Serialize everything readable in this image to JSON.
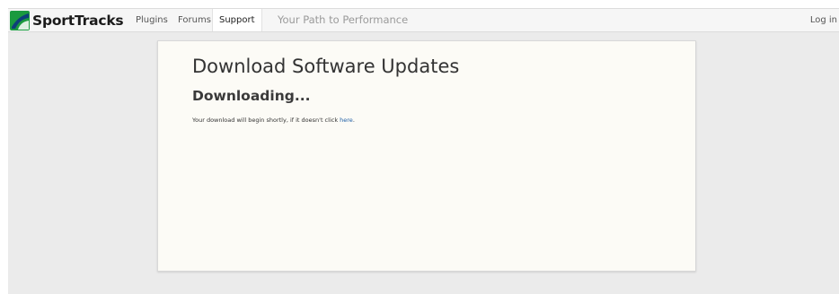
{
  "brand": {
    "name": "SportTracks",
    "logo_icon": "sporttracks-logo-icon",
    "logo_colors": {
      "background": "#1a9a3f",
      "swoosh": "#0e3f7a"
    }
  },
  "nav": {
    "items": [
      {
        "label": "Plugins"
      },
      {
        "label": "Forums"
      },
      {
        "label": "Support",
        "active": true
      }
    ],
    "tagline": "Your Path to Performance",
    "login_label": "Log in"
  },
  "main": {
    "title": "Download Software Updates",
    "subtitle": "Downloading...",
    "message_prefix": "Your download will begin shortly, if it doesn't click ",
    "message_link": "here",
    "message_suffix": "."
  },
  "colors": {
    "page_background": "#ebebeb",
    "card_background": "#fcfbf6",
    "link": "#1f5fa6"
  }
}
